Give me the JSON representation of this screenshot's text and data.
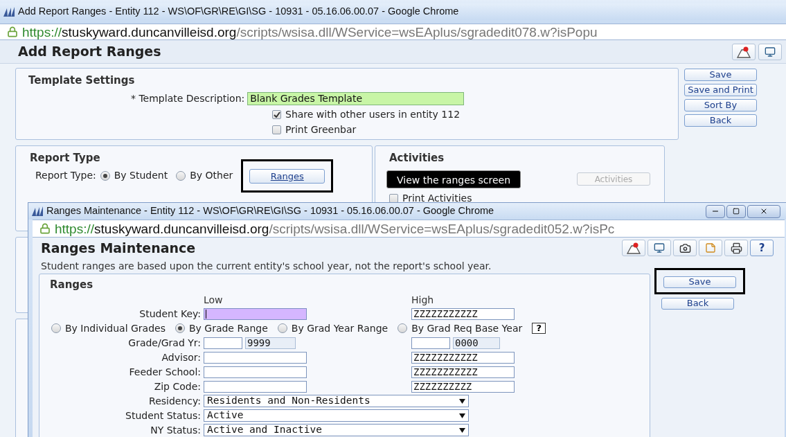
{
  "main_window": {
    "title": "Add Report Ranges - Entity 112 - WS\\OF\\GR\\RE\\GI\\SG - 10931 - 05.16.06.00.07 - Google Chrome",
    "url": {
      "scheme": "https://",
      "host": "stuskyward.duncanvilleisd.org",
      "path": "/scripts/wsisa.dll/WService=wsEAplus/sgradedit078.w?isPopu"
    },
    "header": "Add Report Ranges",
    "template_settings": {
      "title": "Template Settings",
      "description_label": "* Template Description:",
      "description_value": "Blank Grades Template",
      "checkboxes": [
        {
          "label": "Share with other users in entity 112",
          "checked": true
        },
        {
          "label": "Print Greenbar",
          "checked": false
        }
      ]
    },
    "side_buttons": [
      "Save",
      "Save and Print",
      "Sort By",
      "Back"
    ],
    "report_type": {
      "title": "Report Type",
      "label": "Report Type:",
      "options": [
        {
          "label": "By Student",
          "selected": true
        },
        {
          "label": "By Other",
          "selected": false
        }
      ],
      "ranges_button": {
        "label": "Ranges",
        "highlighted": true
      }
    },
    "tooltip": "View the ranges screen",
    "activities": {
      "title": "Activities",
      "button": {
        "label": "Activities",
        "disabled": true
      },
      "checkbox": {
        "label": "Print Activities",
        "checked": false
      }
    }
  },
  "popup": {
    "title": "Ranges Maintenance - Entity 112 - WS\\OF\\GR\\RE\\GI\\SG - 10931 - 05.16.06.00.07 - Google Chrome",
    "url": {
      "scheme": "https://",
      "host": "stuskyward.duncanvilleisd.org",
      "path": "/scripts/wsisa.dll/WService=wsEAplus/sgradedit052.w?isPc"
    },
    "header": "Ranges Maintenance",
    "help": "?",
    "note": "Student ranges are based upon the current entity's school year, not the report's school year.",
    "ranges": {
      "title": "Ranges",
      "low_label": "Low",
      "high_label": "High",
      "rows": [
        {
          "kind": "text",
          "label": "Student Key:",
          "high": "ZZZZZZZZZZZ",
          "focused": true
        },
        {
          "kind": "radios",
          "options": [
            {
              "label": "By Individual Grades",
              "selected": false
            },
            {
              "label": "By Grade Range",
              "selected": true
            },
            {
              "label": "By Grad Year Range",
              "selected": false
            },
            {
              "label": "By Grad Req Base Year",
              "selected": false
            }
          ],
          "help": "?"
        },
        {
          "kind": "pair",
          "label": "Grade/Grad Yr:",
          "low_second": "9999",
          "high_second": "0000"
        },
        {
          "kind": "text",
          "label": "Advisor:",
          "high": "ZZZZZZZZZZZ",
          "focused": false
        },
        {
          "kind": "text",
          "label": "Feeder School:",
          "high": "ZZZZZZZZZZZ",
          "focused": false
        },
        {
          "kind": "text",
          "label": "Zip Code:",
          "high": "ZZZZZZZZZZ",
          "focused": false
        },
        {
          "kind": "select",
          "label": "Residency:",
          "value": "Residents and Non-Residents"
        },
        {
          "kind": "select",
          "label": "Student Status:",
          "value": "Active"
        },
        {
          "kind": "select",
          "label": "NY Status:",
          "value": "Active and Inactive"
        }
      ]
    },
    "buttons": [
      {
        "label": "Save",
        "highlighted": true
      },
      {
        "label": "Back",
        "highlighted": false
      }
    ]
  }
}
